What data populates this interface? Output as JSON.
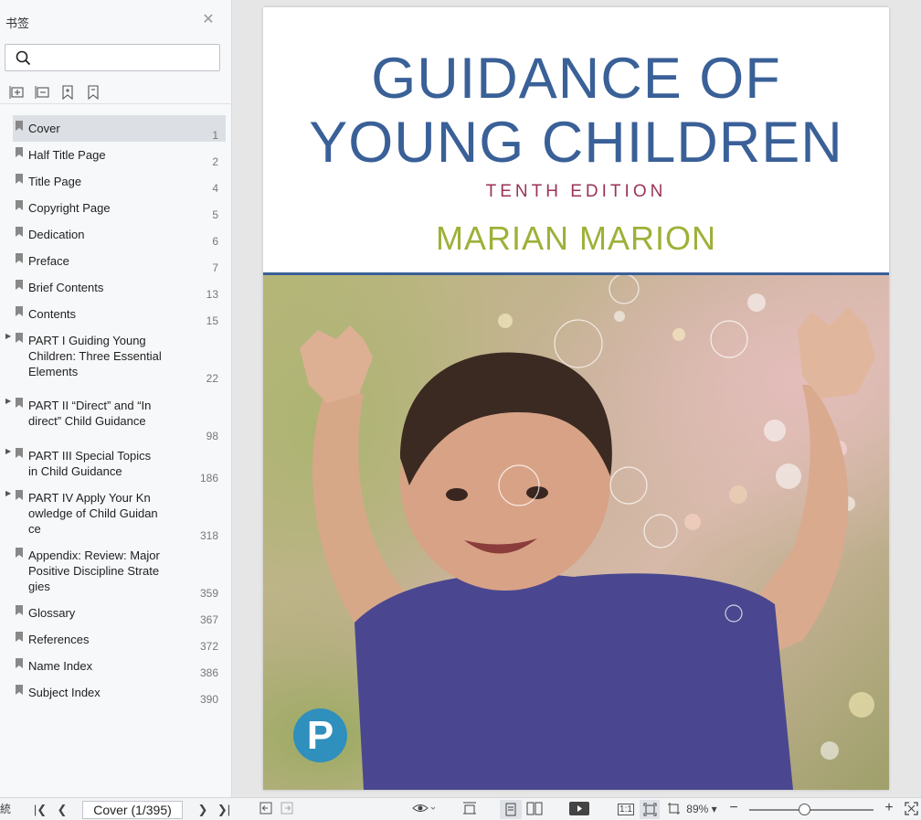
{
  "sidebar": {
    "title": "书签",
    "search_placeholder": "",
    "bookmarks": [
      {
        "label": "Cover",
        "page": "1",
        "expandable": false,
        "selected": true
      },
      {
        "label": "Half Title Page",
        "page": "2",
        "expandable": false
      },
      {
        "label": "Title Page",
        "page": "4",
        "expandable": false
      },
      {
        "label": "Copyright Page",
        "page": "5",
        "expandable": false
      },
      {
        "label": "Dedication",
        "page": "6",
        "expandable": false
      },
      {
        "label": "Preface",
        "page": "7",
        "expandable": false
      },
      {
        "label": "Brief Contents",
        "page": "13",
        "expandable": false
      },
      {
        "label": "Contents",
        "page": "15",
        "expandable": false
      },
      {
        "label": "PART I   Guiding Young\nChildren: Three Essential\nElements",
        "page": "22",
        "expandable": true
      },
      {
        "label": "PART II   “Direct” and “In\ndirect” Child Guidance",
        "page": "98",
        "expandable": true
      },
      {
        "label": "PART III   Special Topics\nin Child Guidance",
        "page": "186",
        "expandable": true
      },
      {
        "label": "PART IV   Apply Your Kn\nowledge of Child Guidan\nce",
        "page": "318",
        "expandable": true
      },
      {
        "label": "Appendix: Review: Major\nPositive Discipline Strate\ngies",
        "page": "359",
        "expandable": false
      },
      {
        "label": "Glossary",
        "page": "367",
        "expandable": false
      },
      {
        "label": "References",
        "page": "372",
        "expandable": false
      },
      {
        "label": "Name Index",
        "page": "386",
        "expandable": false
      },
      {
        "label": "Subject Index",
        "page": "390",
        "expandable": false
      }
    ]
  },
  "cover": {
    "title_line1": "GUIDANCE OF",
    "title_line2": "YOUNG CHILDREN",
    "edition": "TENTH EDITION",
    "author": "MARIAN MARION",
    "publisher_logo_letter": "P",
    "colors": {
      "title": "#3a6098",
      "edition": "#9a3358",
      "author": "#9fb038",
      "logo": "#2f8fbd"
    }
  },
  "footer": {
    "left_cut_text": "統",
    "page_indicator": "Cover (1/395)",
    "zoom": "89%",
    "zoom_fraction": 0.44,
    "view_1to1": "1:1"
  }
}
